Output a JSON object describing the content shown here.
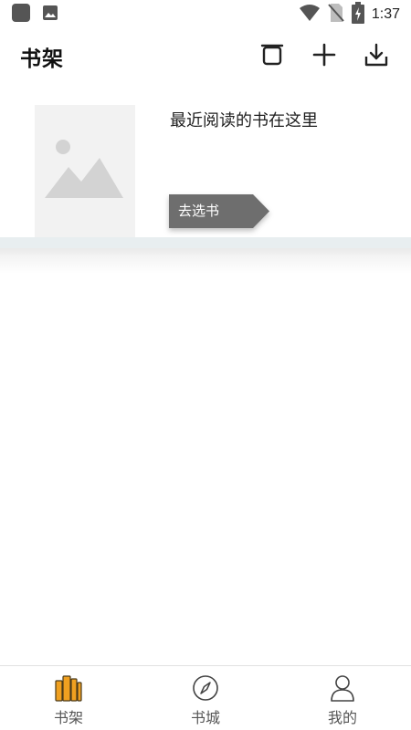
{
  "status_bar": {
    "time": "1:37",
    "icons": [
      "notification-square-icon",
      "image-icon",
      "wifi-icon",
      "no-sim-icon",
      "battery-charging-icon"
    ]
  },
  "header": {
    "title": "书架",
    "actions": [
      "bookshelf-box-icon",
      "plus-icon",
      "download-icon"
    ]
  },
  "recent": {
    "text": "最近阅读的书在这里",
    "choose_label": "去选书",
    "choose_color": "#6e6e6e",
    "cover_icon": "image-placeholder-icon"
  },
  "bottom_nav": {
    "items": [
      {
        "label": "书架",
        "icon": "bookshelf-icon",
        "active": true
      },
      {
        "label": "书城",
        "icon": "compass-icon",
        "active": false
      },
      {
        "label": "我的",
        "icon": "person-icon",
        "active": false
      }
    ],
    "active_color": "#f0a020"
  }
}
